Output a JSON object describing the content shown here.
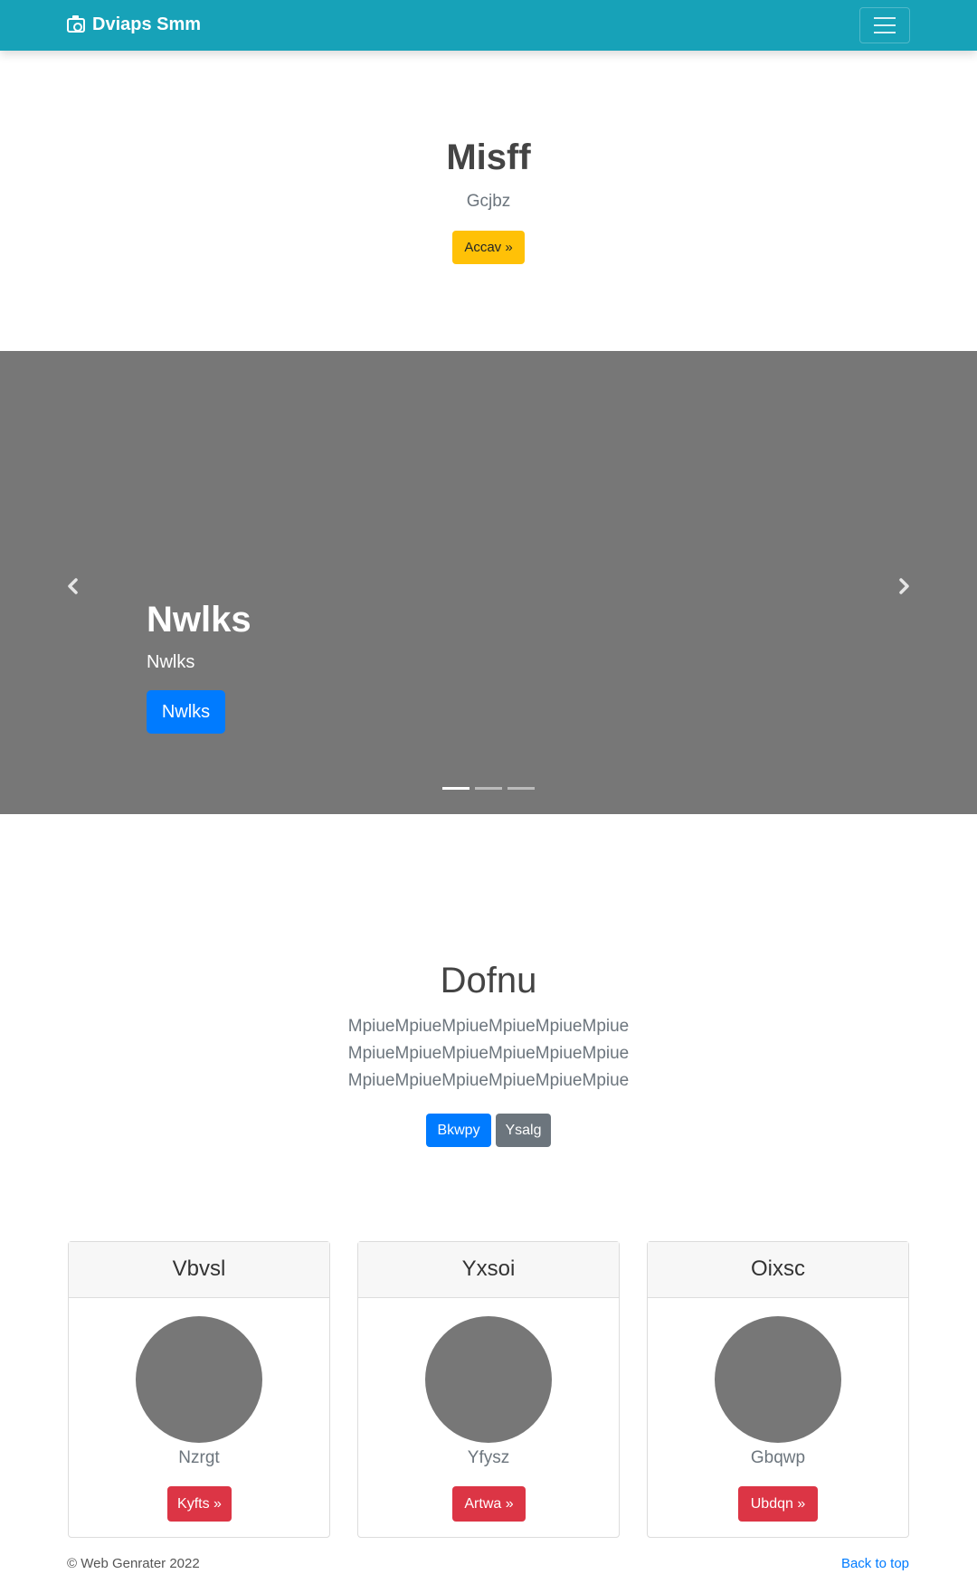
{
  "navbar": {
    "brand": "Dviaps Smm",
    "brand_icon": "camera-icon",
    "toggler_icon": "hamburger-icon"
  },
  "hero": {
    "title": "Misff",
    "subtitle": "Gcjbz",
    "button": "Accav »"
  },
  "carousel": {
    "title": "Nwlks",
    "subtitle": "Nwlks",
    "button": "Nwlks",
    "active_slide": 1,
    "slide_count": 3
  },
  "section": {
    "title": "Dofnu",
    "text": "MpiueMpiueMpiueMpiueMpiueMpiue MpiueMpiueMpiueMpiueMpiueMpiue MpiueMpiueMpiueMpiueMpiueMpiue",
    "primary_button": "Bkwpy",
    "secondary_button": "Ysalg"
  },
  "cards": [
    {
      "header": "Vbvsl",
      "text": "Nzrgt",
      "button": "Kyfts »"
    },
    {
      "header": "Yxsoi",
      "text": "Yfysz",
      "button": "Artwa »"
    },
    {
      "header": "Oixsc",
      "text": "Gbqwp",
      "button": "Ubdqn »"
    }
  ],
  "footer": {
    "copyright": "© Web Genrater 2022",
    "back_to_top": "Back to top"
  },
  "colors": {
    "navbar": "#17a2b8",
    "warning": "#ffc107",
    "primary": "#007bff",
    "secondary": "#6c757d",
    "danger": "#dc3545",
    "placeholder": "#777777"
  }
}
